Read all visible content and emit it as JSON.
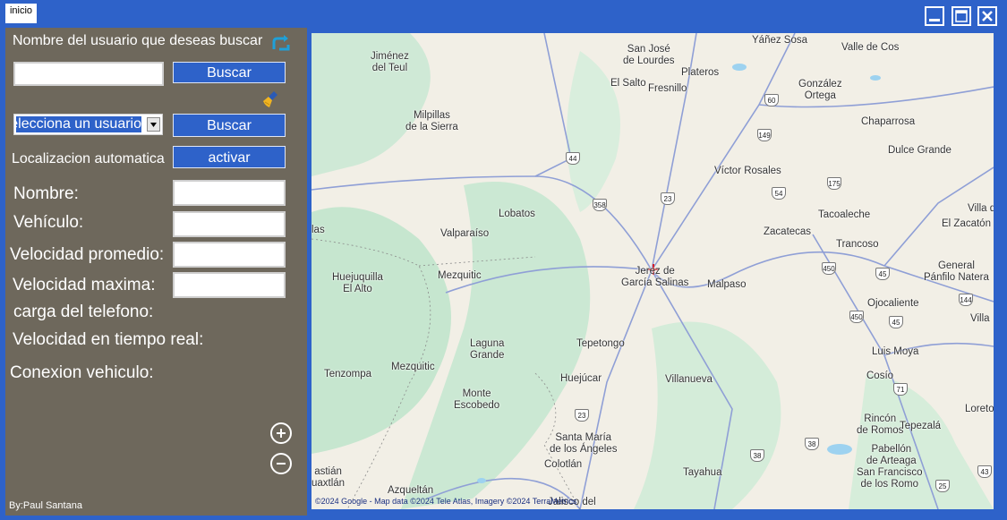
{
  "window": {
    "tab_label": "inicio",
    "controls": {
      "minimize_icon": "minimize-icon",
      "maximize_icon": "maximize-icon",
      "close_icon": "close-icon"
    }
  },
  "panel": {
    "search_prompt": "Nombre del usuario que deseas buscar",
    "search_input_value": "",
    "search_button": "Buscar",
    "select_value": "Selecciona un usuario",
    "select_button": "Buscar",
    "auto_location_label": "Localizacion automatica",
    "activate_button": "activar",
    "fields": {
      "nombre": "Nombre:",
      "vehiculo": "Vehículo:",
      "velocidad_promedio": "Velocidad promedio:",
      "velocidad_maxima": "Velocidad maxima:",
      "carga_telefono": "carga del telefono:",
      "velocidad_tiempo_real": "Velocidad en tiempo real:",
      "conexion_vehiculo": "Conexion vehiculo:"
    },
    "credit": "By:Paul Santana"
  },
  "map": {
    "copyright": "©2024 Google - Map data ©2024 Tele Atlas, Imagery ©2024 TerraMetrics",
    "places": [
      "Yáñez Sosa",
      "San José\nde Lourdes",
      "Jiménez\ndel Teul",
      "Valle de Cos",
      "Plateros",
      "El Salto",
      "Fresnillo",
      "González\nOrtega",
      "Chaparrosa",
      "Milpillas\nde la Sierra",
      "Dulce Grande",
      "Víctor Rosales",
      "Lobatos",
      "Tacoaleche",
      "Villa d",
      "El Zacatón",
      "Valparaíso",
      "Zacatecas",
      "Trancoso",
      "las",
      "Huejuquilla\nEl Alto",
      "Mezquitic",
      "Jerez de\nGarcía Salinas",
      "Malpaso",
      "General\nPánfilo Natera",
      "Ojocaliente",
      "Villa",
      "Laguna\nGrande",
      "Tepetongo",
      "Luis Moya",
      "Tenzompa",
      "Mezquitic",
      "Huejúcar",
      "Villanueva",
      "Cosío",
      "Monte\nEscobedo",
      "Loreto",
      "Rincón\nde Romos",
      "Tepezalá",
      "Santa María\nde los Ángeles",
      "Pabellón\nde Arteaga",
      "Colotlán",
      "Tayahua",
      "San Francisco\nde los Romo",
      "astián\nuaxtlán",
      "Azqueltán",
      "Jalisco del"
    ],
    "route_shields": [
      "60",
      "149",
      "44",
      "54",
      "175",
      "23",
      "358",
      "45",
      "450",
      "450",
      "45",
      "144",
      "71",
      "23",
      "38",
      "38",
      "43",
      "25"
    ]
  }
}
